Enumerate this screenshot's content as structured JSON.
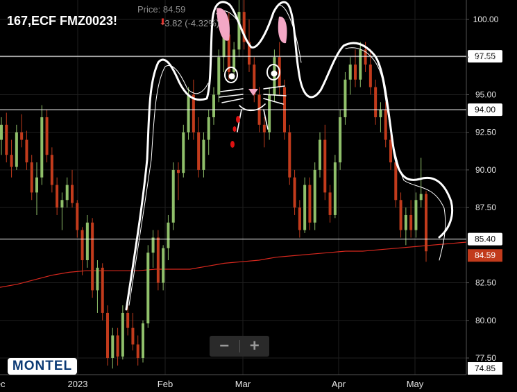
{
  "header": {
    "title": "167,ECF FMZ0023!",
    "price_label": "Price: 84.59",
    "change": "-3.82 (-4.32%)"
  },
  "zoom": {
    "minus": "−",
    "plus": "+"
  },
  "logo": {
    "text": "MONTEL"
  },
  "chart_data": {
    "type": "candlestick",
    "ylim": [
      74.85,
      102.0
    ],
    "y_ticks": [
      "100.00",
      "97.50",
      "95.00",
      "92.50",
      "90.00",
      "87.50",
      "82.50",
      "80.00",
      "77.50"
    ],
    "x_ticks": [
      "Dec",
      "2023",
      "Feb",
      "Mar",
      "Apr",
      "May"
    ],
    "horizontal_lines": [
      {
        "value": 97.55,
        "label": "97.55"
      },
      {
        "value": 94.0,
        "label": "94.00"
      },
      {
        "value": 85.4,
        "label": "85.40"
      }
    ],
    "last_price": {
      "value": 84.59,
      "label": "84.59",
      "color": "#c23b1c"
    },
    "min_price": {
      "value": 74.85,
      "label": "74.85"
    },
    "colors": {
      "up": "#8fbf6a",
      "down": "#c23b1c",
      "ma": "#d8281e"
    },
    "moving_average": [
      82.2,
      82.4,
      82.7,
      83.0,
      83.2,
      83.3,
      83.3,
      83.3,
      83.3,
      83.4,
      83.4,
      83.4,
      83.6,
      83.8,
      83.9,
      84.0,
      84.2,
      84.3,
      84.4,
      84.5,
      84.6,
      84.6,
      84.7,
      84.8,
      84.9,
      85.0,
      85.1,
      85.2
    ],
    "candles": [
      [
        92.0,
        93.5,
        91.0,
        93.0
      ],
      [
        93.0,
        93.8,
        90.5,
        91.0
      ],
      [
        91.0,
        92.0,
        89.5,
        90.2
      ],
      [
        90.2,
        93.0,
        90.0,
        92.5
      ],
      [
        92.5,
        93.7,
        91.5,
        92.0
      ],
      [
        92.0,
        92.6,
        90.0,
        90.5
      ],
      [
        90.5,
        91.0,
        88.0,
        88.5
      ],
      [
        88.5,
        90.5,
        87.0,
        89.5
      ],
      [
        89.5,
        94.3,
        89.0,
        93.5
      ],
      [
        93.5,
        94.0,
        90.5,
        91.0
      ],
      [
        91.0,
        91.5,
        88.5,
        89.0
      ],
      [
        89.0,
        89.5,
        87.0,
        87.5
      ],
      [
        87.5,
        88.5,
        86.0,
        88.0
      ],
      [
        88.0,
        89.5,
        87.5,
        89.0
      ],
      [
        89.0,
        90.0,
        87.5,
        87.8
      ],
      [
        87.8,
        88.0,
        85.5,
        86.0
      ],
      [
        86.0,
        86.2,
        83.0,
        84.0
      ],
      [
        84.0,
        87.0,
        83.5,
        86.5
      ],
      [
        86.5,
        86.8,
        81.5,
        82.0
      ],
      [
        82.0,
        84.0,
        80.5,
        83.5
      ],
      [
        83.5,
        83.8,
        80.0,
        80.5
      ],
      [
        80.5,
        81.0,
        77.0,
        77.5
      ],
      [
        77.5,
        79.5,
        76.8,
        79.0
      ],
      [
        79.0,
        79.5,
        77.0,
        77.6
      ],
      [
        77.6,
        81.0,
        77.4,
        80.5
      ],
      [
        80.5,
        81.5,
        79.0,
        79.5
      ],
      [
        79.5,
        80.5,
        78.0,
        78.4
      ],
      [
        78.4,
        79.0,
        77.0,
        77.5
      ],
      [
        77.5,
        80.0,
        77.2,
        79.8
      ],
      [
        79.8,
        85.0,
        79.5,
        84.5
      ],
      [
        84.5,
        86.0,
        83.5,
        85.5
      ],
      [
        85.5,
        86.0,
        82.0,
        82.5
      ],
      [
        82.5,
        85.0,
        82.0,
        84.8
      ],
      [
        84.8,
        87.0,
        84.0,
        86.5
      ],
      [
        86.5,
        90.5,
        86.0,
        90.0
      ],
      [
        90.0,
        90.5,
        88.0,
        89.8
      ],
      [
        89.8,
        93.0,
        89.5,
        92.5
      ],
      [
        92.5,
        95.5,
        92.0,
        95.0
      ],
      [
        95.0,
        96.0,
        92.0,
        92.5
      ],
      [
        92.5,
        93.5,
        89.5,
        90.0
      ],
      [
        90.0,
        92.5,
        89.5,
        92.0
      ],
      [
        92.0,
        94.0,
        91.0,
        93.5
      ],
      [
        93.5,
        95.5,
        93.0,
        95.0
      ],
      [
        95.0,
        98.0,
        94.5,
        97.5
      ],
      [
        97.5,
        99.5,
        96.5,
        99.0
      ],
      [
        99.0,
        100.5,
        96.0,
        96.5
      ],
      [
        96.5,
        98.5,
        96.0,
        98.0
      ],
      [
        98.0,
        101.5,
        97.5,
        100.5
      ],
      [
        100.5,
        101.5,
        98.0,
        98.5
      ],
      [
        98.5,
        100.0,
        96.5,
        97.0
      ],
      [
        97.0,
        97.5,
        94.5,
        95.0
      ],
      [
        95.0,
        95.5,
        92.5,
        93.0
      ],
      [
        93.0,
        93.5,
        91.5,
        92.5
      ],
      [
        92.5,
        95.5,
        92.0,
        95.0
      ],
      [
        95.0,
        98.0,
        94.5,
        97.5
      ],
      [
        97.5,
        98.5,
        95.0,
        95.5
      ],
      [
        95.5,
        96.0,
        92.0,
        92.5
      ],
      [
        92.5,
        93.0,
        89.0,
        89.5
      ],
      [
        89.5,
        90.0,
        87.0,
        87.5
      ],
      [
        87.5,
        88.0,
        85.5,
        86.0
      ],
      [
        86.0,
        89.5,
        85.8,
        89.0
      ],
      [
        89.0,
        89.5,
        86.0,
        86.5
      ],
      [
        86.5,
        90.5,
        86.0,
        90.0
      ],
      [
        90.0,
        92.5,
        89.5,
        92.0
      ],
      [
        92.0,
        93.0,
        88.0,
        88.5
      ],
      [
        88.5,
        89.0,
        86.5,
        87.0
      ],
      [
        87.0,
        91.0,
        86.8,
        90.5
      ],
      [
        90.5,
        94.0,
        90.0,
        93.5
      ],
      [
        93.5,
        96.5,
        93.0,
        96.0
      ],
      [
        96.0,
        97.5,
        95.0,
        97.0
      ],
      [
        97.0,
        98.0,
        95.5,
        96.0
      ],
      [
        96.0,
        98.5,
        95.5,
        98.0
      ],
      [
        98.0,
        98.5,
        96.5,
        97.0
      ],
      [
        97.0,
        98.0,
        95.0,
        95.5
      ],
      [
        95.5,
        96.0,
        93.0,
        93.5
      ],
      [
        93.5,
        94.5,
        92.5,
        94.0
      ],
      [
        94.0,
        94.5,
        91.5,
        92.0
      ],
      [
        92.0,
        93.0,
        90.0,
        90.5
      ],
      [
        90.5,
        91.0,
        87.5,
        88.0
      ],
      [
        88.0,
        88.5,
        85.5,
        86.0
      ],
      [
        86.0,
        87.5,
        85.0,
        87.0
      ],
      [
        87.0,
        88.0,
        85.5,
        86.0
      ],
      [
        86.0,
        88.5,
        85.5,
        88.0
      ],
      [
        88.0,
        90.8,
        87.5,
        88.4
      ],
      [
        88.4,
        88.6,
        83.9,
        84.59
      ]
    ]
  },
  "annotation": {
    "description": "white hand-drawn cat outline over the price series"
  }
}
